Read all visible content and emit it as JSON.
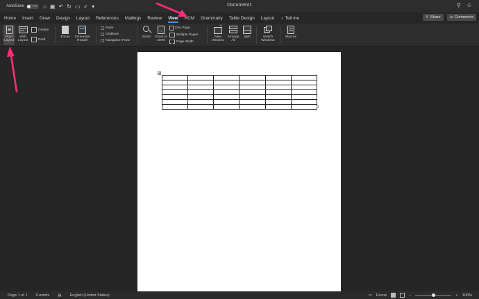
{
  "titlebar": {
    "autosave_label": "AutoSave",
    "autosave_state": "OFF",
    "document_title": "Document1",
    "qat_icons": [
      "home-icon",
      "save-icon",
      "undo-icon",
      "redo-icon",
      "print-icon",
      "check-icon",
      "customize-icon"
    ]
  },
  "tabs": [
    {
      "label": "Home"
    },
    {
      "label": "Insert"
    },
    {
      "label": "Draw"
    },
    {
      "label": "Design"
    },
    {
      "label": "Layout"
    },
    {
      "label": "References"
    },
    {
      "label": "Mailings"
    },
    {
      "label": "Review"
    },
    {
      "label": "View",
      "active": true
    },
    {
      "label": "RCM"
    },
    {
      "label": "Grammarly"
    },
    {
      "label": "Table Design"
    },
    {
      "label": "Layout"
    }
  ],
  "tell_me": "Tell me",
  "share": {
    "share_label": "Share",
    "comments_label": "Comments"
  },
  "ribbon": {
    "print_layout": "Print Layout",
    "web_layout": "Web Layout",
    "outline": "Outline",
    "draft": "Draft",
    "focus": "Focus",
    "immersive_reader": "Immersive Reader",
    "ruler": "Ruler",
    "gridlines": "Gridlines",
    "navigation_pane": "Navigation Pane",
    "zoom": "Zoom",
    "zoom_100": "Zoom to 100%",
    "one_page": "One Page",
    "multiple_pages": "Multiple Pages",
    "page_width": "Page Width",
    "new_window": "New Window",
    "arrange_all": "Arrange All",
    "split": "Split",
    "switch_windows": "Switch Windows",
    "macros": "Macros"
  },
  "document": {
    "table_rows": 7,
    "table_cols": 6
  },
  "status": {
    "page": "Page 1 of 1",
    "words": "0 words",
    "language": "English (United States)",
    "focus": "Focus",
    "zoom": "100%",
    "zoom_value": 100
  },
  "annotation_color": "#ff2d78"
}
